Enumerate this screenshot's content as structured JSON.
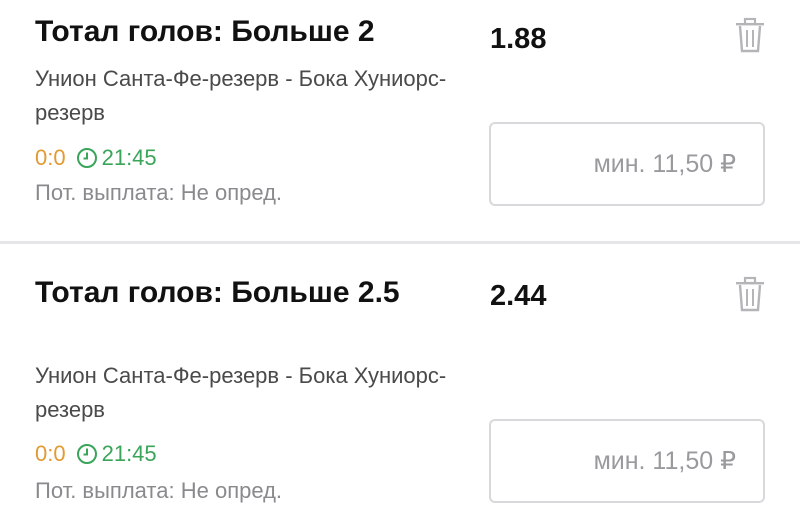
{
  "bets": [
    {
      "market": "Тотал голов: Больше 2",
      "odds": "1.88",
      "event": "Унион Санта-Фе-резерв - Бока Хуниорс-резерв",
      "score": "0:0",
      "time": "21:45",
      "payout": "Пот. выплата: Не опред.",
      "stake_placeholder": "мин. 11,50 ₽",
      "stake_value": ""
    },
    {
      "market": "Тотал голов: Больше 2.5",
      "odds": "2.44",
      "event": "Унион Санта-Фе-резерв - Бока Хуниорс-резерв",
      "score": "0:0",
      "time": "21:45",
      "payout": "Пот. выплата: Не опред.",
      "stake_placeholder": "мин. 11,50 ₽",
      "stake_value": ""
    }
  ],
  "icons": {
    "delete": "trash-icon",
    "time": "clock-icon"
  },
  "colors": {
    "score": "#e29a33",
    "time": "#3aa55a",
    "payout": "#8a8a8e",
    "divider": "#e6e6e8"
  }
}
